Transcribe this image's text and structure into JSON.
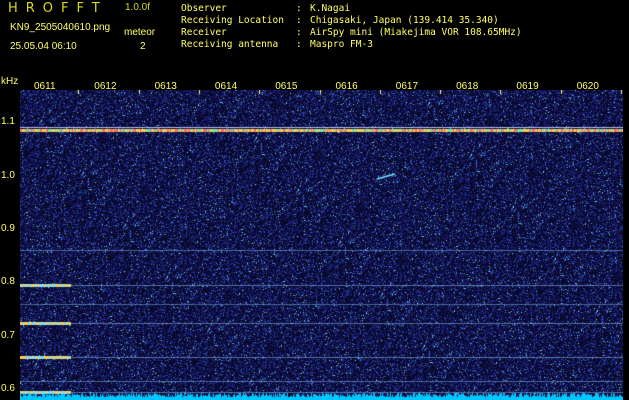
{
  "header": {
    "logo": "HROFFT",
    "version": "1.0.0f",
    "filename": "KN9_2505040610.png",
    "meteor_label": "meteor",
    "datetime": "25.05.04 06:10",
    "meteor_count": "2"
  },
  "info": [
    {
      "key": "Observer",
      "value": "K.Nagai"
    },
    {
      "key": "Receiving Location",
      "value": "Chigasaki, Japan (139.414 35.340)"
    },
    {
      "key": "Receiver",
      "value": "AirSpy mini (Miakejima VOR 108.65MHz)"
    },
    {
      "key": "Receiving antenna",
      "value": "Maspro FM-3"
    }
  ],
  "colors": {
    "background": "#000000",
    "text": "#ffff66",
    "logo": "#d8d820",
    "noise_base": "#1a1a70",
    "signal_line": "#ffd04a",
    "baseline": "#00e0ff"
  },
  "chart_data": {
    "type": "heatmap",
    "title": "",
    "xlabel": "",
    "ylabel": "kHz",
    "x_ticks": [
      "0611",
      "0612",
      "0613",
      "0614",
      "0615",
      "0616",
      "0617",
      "0618",
      "0619",
      "0620"
    ],
    "y_ticks": [
      "1.1",
      "1.0",
      "0.9",
      "0.8",
      "0.7",
      "0.6"
    ],
    "y_range_khz": [
      0.58,
      1.16
    ],
    "features": {
      "persistent_carrier_khz": 1.085,
      "short_carriers_khz": [
        0.795,
        0.725,
        0.66,
        0.595
      ],
      "short_carrier_end_minute": "0611",
      "faint_lines_khz": [
        0.86,
        0.76,
        0.615
      ],
      "meteor_streak": {
        "start_time": "0617",
        "center_khz": 1.0
      }
    }
  }
}
